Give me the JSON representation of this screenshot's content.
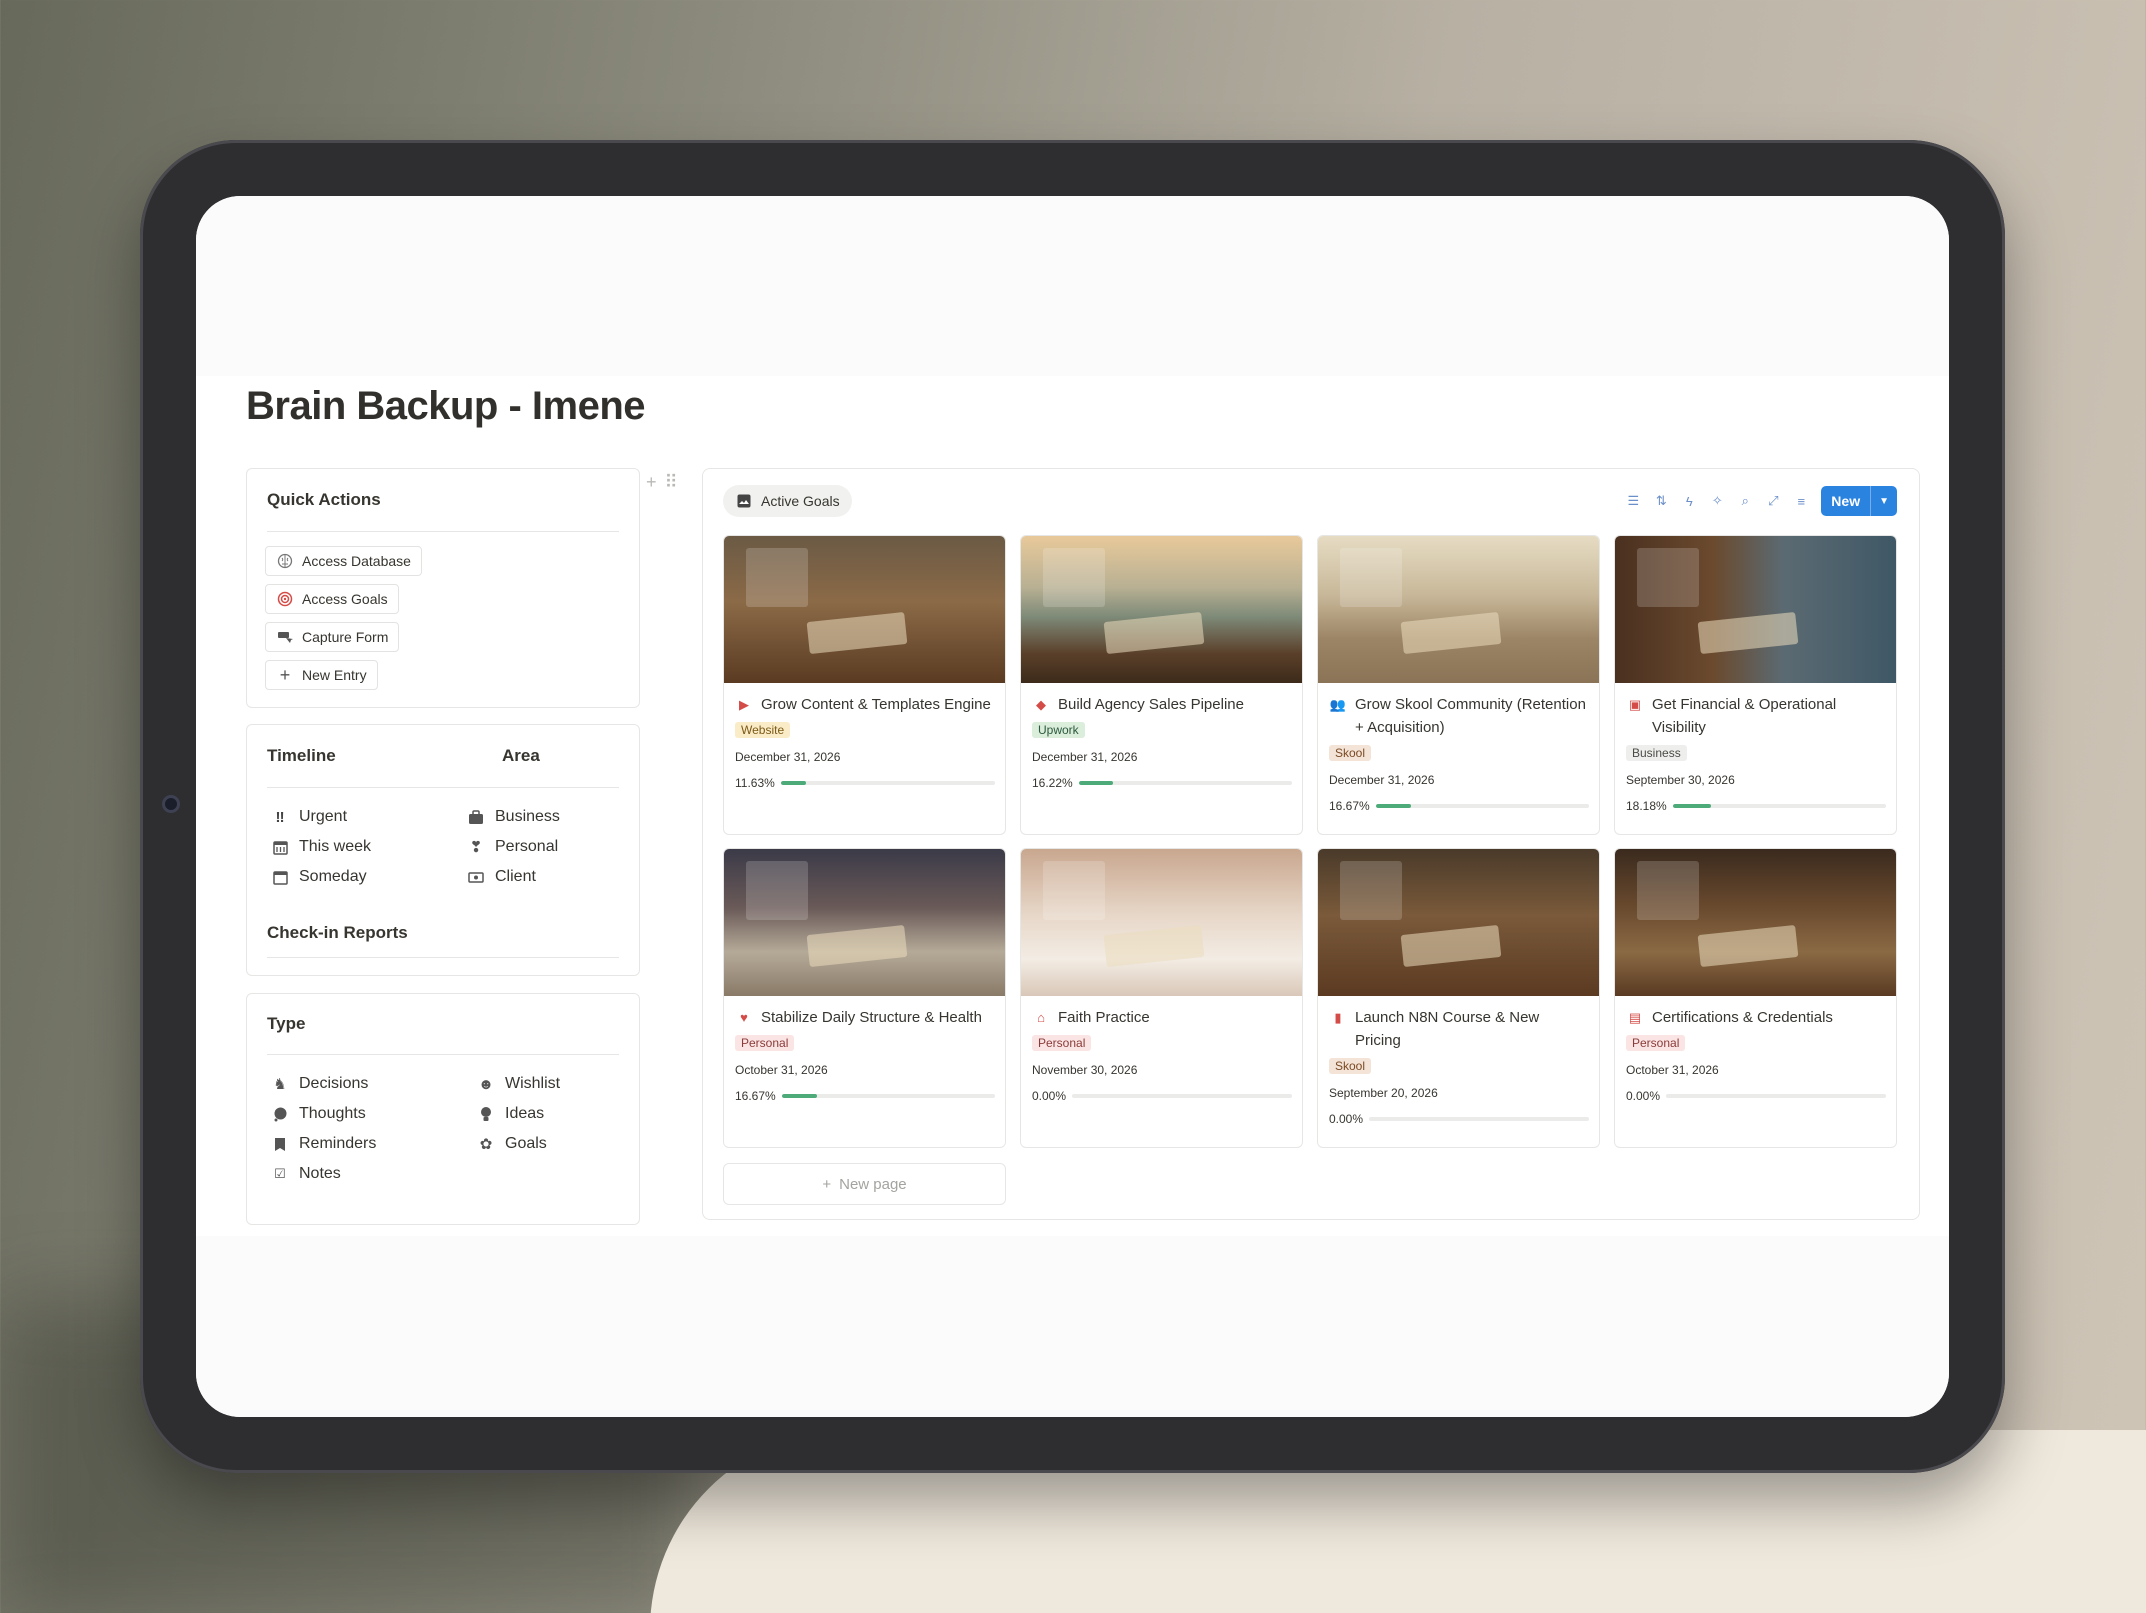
{
  "page": {
    "title": "Brain Backup - Imene"
  },
  "quick_actions": {
    "heading": "Quick Actions",
    "items": [
      {
        "label": "Access Database",
        "icon": "brain-icon"
      },
      {
        "label": "Access Goals",
        "icon": "target-icon"
      },
      {
        "label": "Capture Form",
        "icon": "form-icon"
      },
      {
        "label": "New Entry",
        "icon": "plus-icon"
      }
    ]
  },
  "timeline_area": {
    "timeline_heading": "Timeline",
    "area_heading": "Area",
    "timeline": [
      {
        "label": "Urgent",
        "icon": "exclamation-icon"
      },
      {
        "label": "This week",
        "icon": "calendar-week-icon"
      },
      {
        "label": "Someday",
        "icon": "calendar-icon"
      }
    ],
    "area": [
      {
        "label": "Business",
        "icon": "briefcase-icon"
      },
      {
        "label": "Personal",
        "icon": "heart-hands-icon"
      },
      {
        "label": "Client",
        "icon": "money-icon"
      }
    ],
    "checkin_heading": "Check-in Reports"
  },
  "type_panel": {
    "heading": "Type",
    "left": [
      {
        "label": "Decisions",
        "icon": "chess-knight-icon"
      },
      {
        "label": "Thoughts",
        "icon": "thought-bubble-icon"
      },
      {
        "label": "Reminders",
        "icon": "bookmark-icon"
      },
      {
        "label": "Notes",
        "icon": "checklist-icon"
      }
    ],
    "right": [
      {
        "label": "Wishlist",
        "icon": "smiley-icon"
      },
      {
        "label": "Ideas",
        "icon": "lightbulb-icon"
      },
      {
        "label": "Goals",
        "icon": "flower-icon"
      }
    ]
  },
  "gallery": {
    "view_tab": "Active Goals",
    "new_button": "New",
    "new_page": "New page",
    "cards": [
      {
        "title": "Grow Content & Templates Engine",
        "icon": "play-circle-icon",
        "tag": "Website",
        "tag_kind": "website",
        "date": "December 31, 2026",
        "progress_label": "11.63%",
        "progress": 0.1163
      },
      {
        "title": "Build Agency Sales Pipeline",
        "icon": "tag-icon",
        "tag": "Upwork",
        "tag_kind": "upwork",
        "date": "December 31, 2026",
        "progress_label": "16.22%",
        "progress": 0.1622
      },
      {
        "title": "Grow Skool Community (Retention + Acquisition)",
        "icon": "people-icon",
        "tag": "Skool",
        "tag_kind": "skool",
        "date": "December 31, 2026",
        "progress_label": "16.67%",
        "progress": 0.1667
      },
      {
        "title": "Get Financial & Operational Visibility",
        "icon": "money-icon",
        "tag": "Business",
        "tag_kind": "business",
        "date": "September 30, 2026",
        "progress_label": "18.18%",
        "progress": 0.1818
      },
      {
        "title": "Stabilize Daily Structure & Health",
        "icon": "heartbeat-icon",
        "tag": "Personal",
        "tag_kind": "personal",
        "date": "October 31, 2026",
        "progress_label": "16.67%",
        "progress": 0.1667
      },
      {
        "title": "Faith Practice",
        "icon": "mosque-icon",
        "tag": "Personal",
        "tag_kind": "personal",
        "date": "November 30, 2026",
        "progress_label": "0.00%",
        "progress": 0
      },
      {
        "title": "Launch N8N Course & New Pricing",
        "icon": "bag-icon",
        "tag": "Skool",
        "tag_kind": "skool",
        "date": "September 20, 2026",
        "progress_label": "0.00%",
        "progress": 0
      },
      {
        "title": "Certifications & Credentials",
        "icon": "certificate-icon",
        "tag": "Personal",
        "tag_kind": "personal",
        "date": "October 31, 2026",
        "progress_label": "0.00%",
        "progress": 0
      }
    ]
  },
  "colors": {
    "accent": "#2b83e0",
    "progress": "#4dab7a",
    "icon_red": "#d44c47"
  }
}
